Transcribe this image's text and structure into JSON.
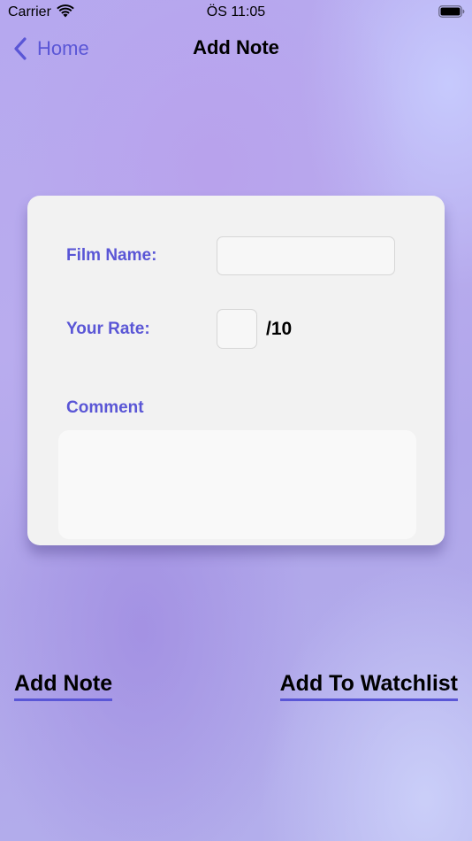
{
  "status_bar": {
    "carrier": "Carrier",
    "time": "ÖS 11:05",
    "icons": [
      "wifi-icon",
      "battery-icon"
    ]
  },
  "nav": {
    "back_label": "Home",
    "back_icon": "chevron-left-icon",
    "title": "Add Note"
  },
  "form": {
    "film_name_label": "Film Name:",
    "film_name_value": "",
    "rate_label": "Your Rate:",
    "rate_value": "",
    "rate_suffix": "/10",
    "comment_label": "Comment",
    "comment_value": ""
  },
  "actions": {
    "add_note_label": "Add Note",
    "add_watchlist_label": "Add To Watchlist"
  },
  "colors": {
    "accent": "#5a56d6",
    "card_background": "#f2f2f2"
  }
}
